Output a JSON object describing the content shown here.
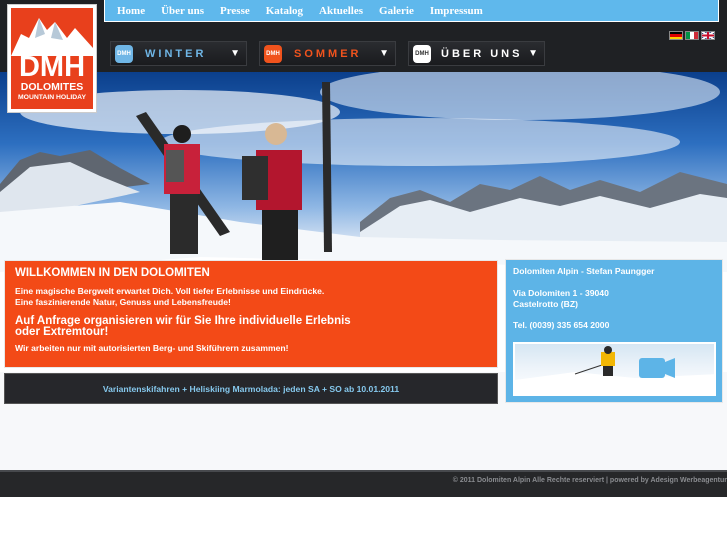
{
  "logo": {
    "text": "DMH",
    "subtitle1": "DOLOMITES",
    "subtitle2": "MOUNTAIN HOLIDAY"
  },
  "top_nav": [
    {
      "label": "Home"
    },
    {
      "label": "Über uns"
    },
    {
      "label": "Presse"
    },
    {
      "label": "Katalog"
    },
    {
      "label": "Aktuelles"
    },
    {
      "label": "Galerie"
    },
    {
      "label": "Impressum"
    }
  ],
  "languages": [
    {
      "icon": "flag-de-icon"
    },
    {
      "icon": "flag-it-icon"
    },
    {
      "icon": "flag-en-icon"
    }
  ],
  "menus": [
    {
      "icon_text": "DMH",
      "label": "WINTER",
      "color": "#6fb6e6",
      "arrow": "▼"
    },
    {
      "icon_text": "DMH",
      "label": "SOMMER",
      "color": "#f0531d",
      "arrow": "▼"
    },
    {
      "icon_text": "DMH",
      "label": "ÜBER UNS",
      "color": "#ffffff",
      "arrow": "▼"
    }
  ],
  "welcome": {
    "title": "WILLKOMMEN IN DEN DOLOMITEN",
    "line1": "Eine magische Bergwelt erwartet Dich. Voll tiefer Erlebnisse und Eindrücke.",
    "line2": "Eine faszinierende Natur, Genuss und Lebensfreude!",
    "highlight": "Auf Anfrage organisieren wir für Sie Ihre individuelle Erlebnis oder Extremtour!",
    "footer": "Wir arbeiten nur mit autorisierten Berg- und Skiführern zusammen!"
  },
  "event": {
    "text": "Variantenskifahren + Heliskiing Marmolada: jeden SA + SO ab 10.01.2011"
  },
  "contact": {
    "name": "Dolomiten Alpin - Stefan Paungger",
    "street": "Via Dolomiten 1 - 39040",
    "city": "Castelrotto (BZ)",
    "phone": "Tel. (0039) 335 654 2000"
  },
  "footer": {
    "text": "© 2011 Dolomiten Alpin Alle Rechte reserviert | powered by Adesign Werbeagentur"
  },
  "colors": {
    "orange": "#f34a17",
    "blue": "#5fb8ec",
    "dark": "#1f2124"
  }
}
